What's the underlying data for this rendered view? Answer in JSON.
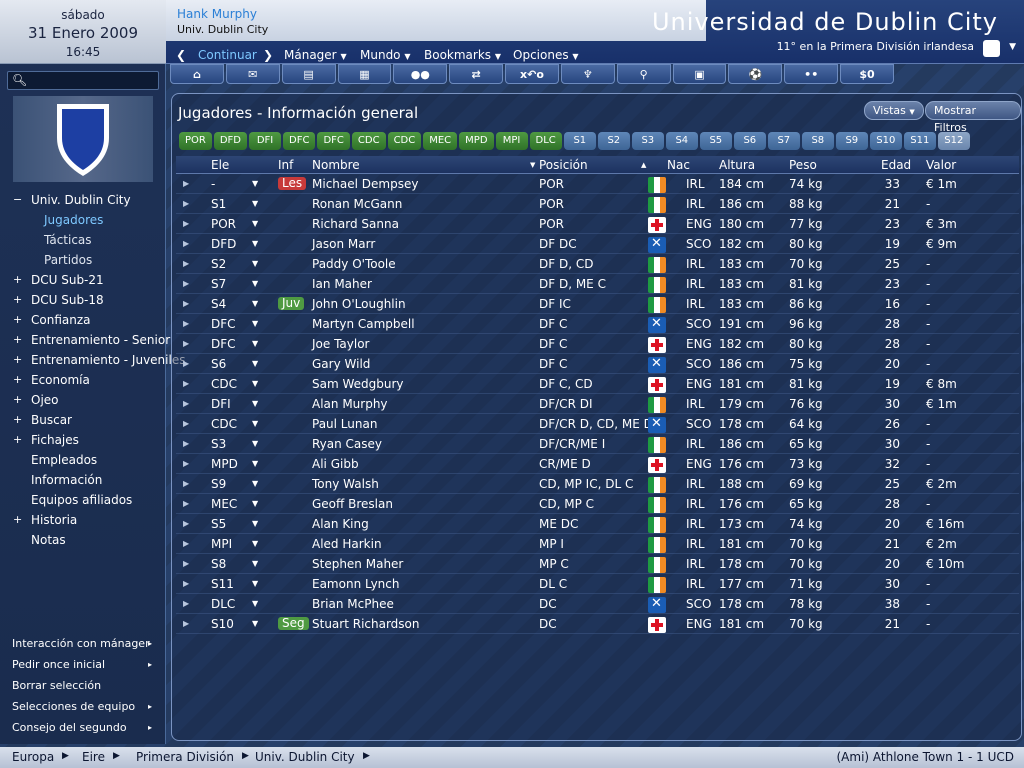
{
  "date": {
    "weekday": "sábado",
    "date": "31 Enero 2009",
    "time": "16:45"
  },
  "header": {
    "manager": "Hank Murphy",
    "club": "Univ. Dublin City",
    "title": "Universidad de Dublin City",
    "league_position": "11° en la Primera División irlandesa",
    "menu": {
      "continue": "Continuar",
      "manager": "Mánager",
      "world": "Mundo",
      "bookmarks": "Bookmarks",
      "options": "Opciones"
    }
  },
  "toolbar": {
    "money": "$0"
  },
  "sidebar": {
    "items": [
      {
        "pm": "−",
        "label": "Univ. Dublin City"
      },
      {
        "pm": "",
        "label": "Jugadores"
      },
      {
        "pm": "",
        "label": "Tácticas"
      },
      {
        "pm": "",
        "label": "Partidos"
      },
      {
        "pm": "+",
        "label": "DCU Sub-21"
      },
      {
        "pm": "+",
        "label": "DCU Sub-18"
      },
      {
        "pm": "+",
        "label": "Confianza"
      },
      {
        "pm": "+",
        "label": "Entrenamiento - Senior"
      },
      {
        "pm": "+",
        "label": "Entrenamiento - Juveniles"
      },
      {
        "pm": "+",
        "label": "Economía"
      },
      {
        "pm": "+",
        "label": "Ojeo"
      },
      {
        "pm": "+",
        "label": "Buscar"
      },
      {
        "pm": "+",
        "label": "Fichajes"
      },
      {
        "pm": "",
        "label": "Empleados"
      },
      {
        "pm": "",
        "label": "Información"
      },
      {
        "pm": "",
        "label": "Equipos afiliados"
      },
      {
        "pm": "+",
        "label": "Historia"
      },
      {
        "pm": "",
        "label": "Notas"
      }
    ],
    "bottom": [
      "Interacción con mánager",
      "Pedir once inicial",
      "Borrar selección",
      "Selecciones de equipo",
      "Consejo del segundo"
    ]
  },
  "panel": {
    "title": "Jugadores - Información general",
    "views_label": "Vistas",
    "filters_label": "Mostrar Filtros",
    "positions": [
      "POR",
      "DFD",
      "DFI",
      "DFC",
      "DFC",
      "CDC",
      "CDC",
      "MEC",
      "MPD",
      "MPI",
      "DLC"
    ],
    "subs": [
      "S1",
      "S2",
      "S3",
      "S4",
      "S5",
      "S6",
      "S7",
      "S8",
      "S9",
      "S10",
      "S11",
      "S12"
    ],
    "columns": {
      "sel": "Ele",
      "inf": "Inf",
      "name": "Nombre",
      "pos": "Posición",
      "nat": "Nac",
      "height": "Altura",
      "weight": "Peso",
      "age": "Edad",
      "value": "Valor"
    },
    "players": [
      {
        "sel": "-",
        "inf": "Les",
        "infc": "red",
        "name": "Michael Dempsey",
        "pos": "POR",
        "nat": "IRL",
        "h": "184 cm",
        "w": "74 kg",
        "age": "33",
        "val": "€ 1m"
      },
      {
        "sel": "S1",
        "inf": "",
        "infc": "",
        "name": "Ronan McGann",
        "pos": "POR",
        "nat": "IRL",
        "h": "186 cm",
        "w": "88 kg",
        "age": "21",
        "val": "-"
      },
      {
        "sel": "POR",
        "inf": "",
        "infc": "",
        "name": "Richard Sanna",
        "pos": "POR",
        "nat": "ENG",
        "h": "180 cm",
        "w": "77 kg",
        "age": "23",
        "val": "€ 3m"
      },
      {
        "sel": "DFD",
        "inf": "",
        "infc": "",
        "name": "Jason Marr",
        "pos": "DF DC",
        "nat": "SCO",
        "h": "182 cm",
        "w": "80 kg",
        "age": "19",
        "val": "€ 9m"
      },
      {
        "sel": "S2",
        "inf": "",
        "infc": "",
        "name": "Paddy O'Toole",
        "pos": "DF D, CD",
        "nat": "IRL",
        "h": "183 cm",
        "w": "70 kg",
        "age": "25",
        "val": "-"
      },
      {
        "sel": "S7",
        "inf": "",
        "infc": "",
        "name": "Ian Maher",
        "pos": "DF D, ME C",
        "nat": "IRL",
        "h": "183 cm",
        "w": "81 kg",
        "age": "23",
        "val": "-"
      },
      {
        "sel": "S4",
        "inf": "Juv",
        "infc": "green",
        "name": "John O'Loughlin",
        "pos": "DF IC",
        "nat": "IRL",
        "h": "183 cm",
        "w": "86 kg",
        "age": "16",
        "val": "-"
      },
      {
        "sel": "DFC",
        "inf": "",
        "infc": "",
        "name": "Martyn Campbell",
        "pos": "DF C",
        "nat": "SCO",
        "h": "191 cm",
        "w": "96 kg",
        "age": "28",
        "val": "-"
      },
      {
        "sel": "DFC",
        "inf": "",
        "infc": "",
        "name": "Joe Taylor",
        "pos": "DF C",
        "nat": "ENG",
        "h": "182 cm",
        "w": "80 kg",
        "age": "28",
        "val": "-"
      },
      {
        "sel": "S6",
        "inf": "",
        "infc": "",
        "name": "Gary Wild",
        "pos": "DF C",
        "nat": "SCO",
        "h": "186 cm",
        "w": "75 kg",
        "age": "20",
        "val": "-"
      },
      {
        "sel": "CDC",
        "inf": "",
        "infc": "",
        "name": "Sam Wedgbury",
        "pos": "DF C, CD",
        "nat": "ENG",
        "h": "181 cm",
        "w": "81 kg",
        "age": "19",
        "val": "€ 8m"
      },
      {
        "sel": "DFI",
        "inf": "",
        "infc": "",
        "name": "Alan Murphy",
        "pos": "DF/CR DI",
        "nat": "IRL",
        "h": "179 cm",
        "w": "76 kg",
        "age": "30",
        "val": "€ 1m"
      },
      {
        "sel": "CDC",
        "inf": "",
        "infc": "",
        "name": "Paul Lunan",
        "pos": "DF/CR D, CD, ME DC",
        "nat": "SCO",
        "h": "178 cm",
        "w": "64 kg",
        "age": "26",
        "val": "-"
      },
      {
        "sel": "S3",
        "inf": "",
        "infc": "",
        "name": "Ryan Casey",
        "pos": "DF/CR/ME I",
        "nat": "IRL",
        "h": "186 cm",
        "w": "65 kg",
        "age": "30",
        "val": "-"
      },
      {
        "sel": "MPD",
        "inf": "",
        "infc": "",
        "name": "Ali Gibb",
        "pos": "CR/ME D",
        "nat": "ENG",
        "h": "176 cm",
        "w": "73 kg",
        "age": "32",
        "val": "-"
      },
      {
        "sel": "S9",
        "inf": "",
        "infc": "",
        "name": "Tony Walsh",
        "pos": "CD, MP IC, DL C",
        "nat": "IRL",
        "h": "188 cm",
        "w": "69 kg",
        "age": "25",
        "val": "€ 2m"
      },
      {
        "sel": "MEC",
        "inf": "",
        "infc": "",
        "name": "Geoff Breslan",
        "pos": "CD, MP C",
        "nat": "IRL",
        "h": "176 cm",
        "w": "65 kg",
        "age": "28",
        "val": "-"
      },
      {
        "sel": "S5",
        "inf": "",
        "infc": "",
        "name": "Alan King",
        "pos": "ME DC",
        "nat": "IRL",
        "h": "173 cm",
        "w": "74 kg",
        "age": "20",
        "val": "€ 16m"
      },
      {
        "sel": "MPI",
        "inf": "",
        "infc": "",
        "name": "Aled Harkin",
        "pos": "MP I",
        "nat": "IRL",
        "h": "181 cm",
        "w": "70 kg",
        "age": "21",
        "val": "€ 2m"
      },
      {
        "sel": "S8",
        "inf": "",
        "infc": "",
        "name": "Stephen Maher",
        "pos": "MP C",
        "nat": "IRL",
        "h": "178 cm",
        "w": "70 kg",
        "age": "20",
        "val": "€ 10m"
      },
      {
        "sel": "S11",
        "inf": "",
        "infc": "",
        "name": "Eamonn Lynch",
        "pos": "DL C",
        "nat": "IRL",
        "h": "177 cm",
        "w": "71 kg",
        "age": "30",
        "val": "-"
      },
      {
        "sel": "DLC",
        "inf": "",
        "infc": "",
        "name": "Brian McPhee",
        "pos": "DC",
        "nat": "SCO",
        "h": "178 cm",
        "w": "78 kg",
        "age": "38",
        "val": "-"
      },
      {
        "sel": "S10",
        "inf": "Seg",
        "infc": "green",
        "name": "Stuart Richardson",
        "pos": "DC",
        "nat": "ENG",
        "h": "181 cm",
        "w": "70 kg",
        "age": "21",
        "val": "-"
      }
    ]
  },
  "status": {
    "crumbs": [
      "Europa",
      "Eire",
      "Primera División",
      "Univ. Dublin City"
    ],
    "result": "(Ami) Athlone Town 1 - 1 UCD"
  }
}
